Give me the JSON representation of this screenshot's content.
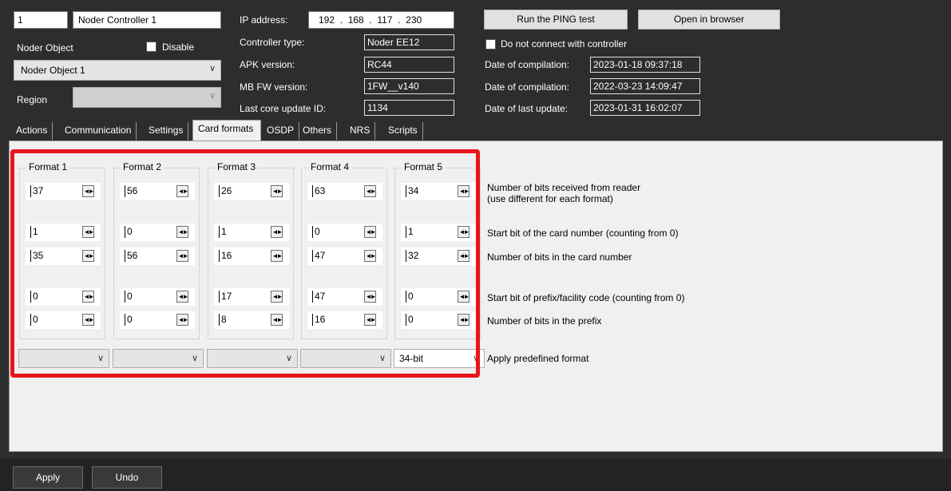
{
  "controller": {
    "number": "1",
    "name": "Noder Controller 1",
    "object_label": "Noder Object",
    "disable_label": "Disable",
    "object_value": "Noder Object 1",
    "region_label": "Region",
    "region_value": ""
  },
  "info": {
    "ip_label": "IP address:",
    "ip_value": "192  .  168  .  117  .  230",
    "type_label": "Controller type:",
    "type_value": "Noder EE12",
    "apk_label": "APK version:",
    "apk_value": "RC44",
    "mbfw_label": "MB FW version:",
    "mbfw_value": "1FW__v140",
    "core_label": "Last core update ID:",
    "core_value": "1134"
  },
  "actions": {
    "ping_label": "Run the PING test",
    "browser_label": "Open in browser",
    "noconnect_label": "Do not connect with controller",
    "compile1_label": "Date of compilation:",
    "compile1_value": "2023-01-18 09:37:18",
    "compile2_label": "Date of compilation:",
    "compile2_value": "2022-03-23 14:09:47",
    "update_label": "Date of last update:",
    "update_value": "2023-01-31 16:02:07"
  },
  "tabs": [
    "Actions",
    "Communication",
    "Settings",
    "Card formats",
    "OSDP",
    "Others",
    "NRS",
    "Scripts"
  ],
  "active_tab": "Card formats",
  "formats": [
    {
      "title": "Format 1",
      "bits": "37",
      "start": "1",
      "num": "35",
      "pstart": "0",
      "pbits": "0",
      "predef": ""
    },
    {
      "title": "Format 2",
      "bits": "56",
      "start": "0",
      "num": "56",
      "pstart": "0",
      "pbits": "0",
      "predef": ""
    },
    {
      "title": "Format 3",
      "bits": "26",
      "start": "1",
      "num": "16",
      "pstart": "17",
      "pbits": "8",
      "predef": ""
    },
    {
      "title": "Format 4",
      "bits": "63",
      "start": "0",
      "num": "47",
      "pstart": "47",
      "pbits": "16",
      "predef": ""
    },
    {
      "title": "Format 5",
      "bits": "34",
      "start": "1",
      "num": "32",
      "pstart": "0",
      "pbits": "0",
      "predef": "34-bit"
    }
  ],
  "row_labels": {
    "bits_line1": "Number of bits received from reader",
    "bits_line2": "(use different for each format)",
    "start": "Start bit of the card number (counting from 0)",
    "num": "Number of bits in the card number",
    "pstart": "Start bit of prefix/facility code (counting from 0)",
    "pbits": "Number of bits in the prefix",
    "predef": "Apply predefined format"
  },
  "footer": {
    "apply_label": "Apply",
    "undo_label": "Undo"
  },
  "colors": {
    "highlight": "#e8141b",
    "panel": "#f0f0f0",
    "background": "#2d2d2d"
  }
}
